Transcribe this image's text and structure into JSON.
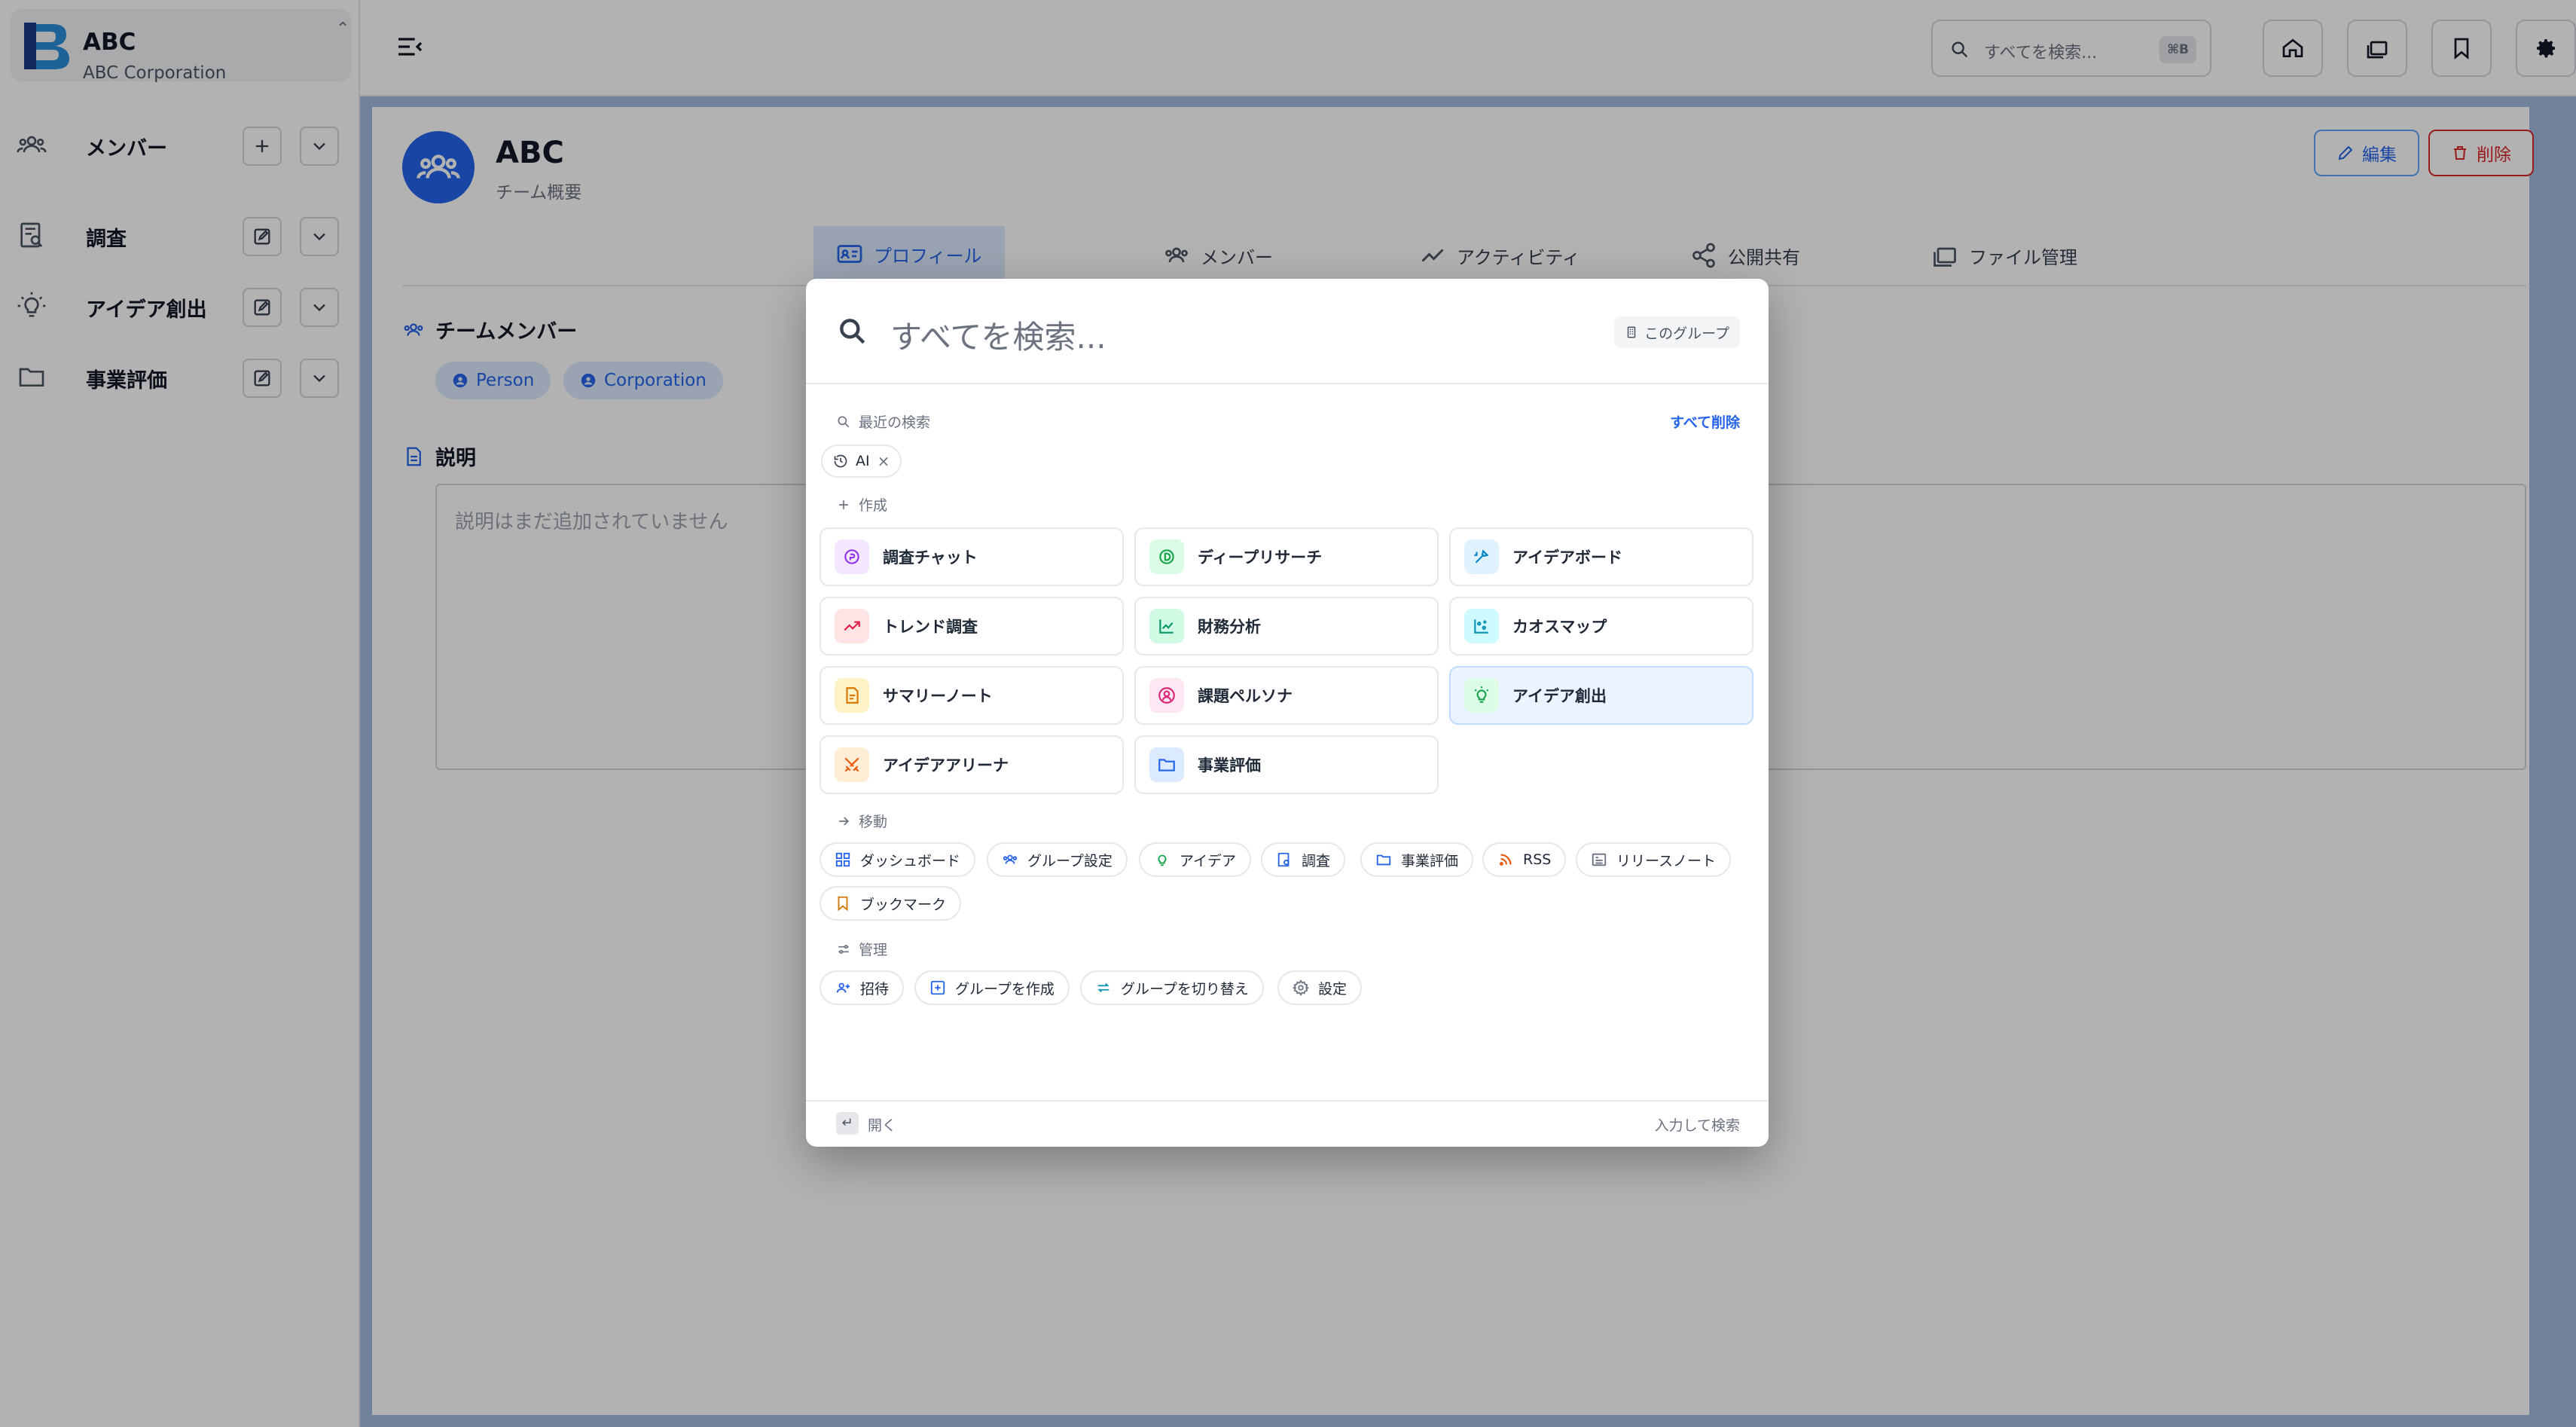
{
  "sidebar": {
    "org_name": "ABC",
    "org_subtitle": "ABC Corporation",
    "toggle_glyph": "⌃",
    "items": [
      {
        "label": "メンバー",
        "icon": "team-icon",
        "action_icon": "plus-icon"
      },
      {
        "label": "調査",
        "icon": "research-doc-icon",
        "action_icon": "edit-icon"
      },
      {
        "label": "アイデア創出",
        "icon": "lightbulb-icon",
        "action_icon": "edit-icon"
      },
      {
        "label": "事業評価",
        "icon": "folder-icon",
        "action_icon": "edit-icon"
      }
    ]
  },
  "header": {
    "search_placeholder": "すべてを検索...",
    "search_shortcut": "⌘B",
    "buttons": [
      "home-icon",
      "library-icon",
      "bookmark-icon",
      "settings-icon"
    ]
  },
  "main": {
    "team_name": "ABC",
    "team_subtitle": "チーム概要",
    "edit_label": "編集",
    "delete_label": "削除",
    "tabs": [
      {
        "label": "プロフィール",
        "active": true
      },
      {
        "label": "メンバー",
        "active": false
      },
      {
        "label": "アクティビティ",
        "active": false
      },
      {
        "label": "公開共有",
        "active": false
      },
      {
        "label": "ファイル管理",
        "active": false
      }
    ],
    "members_title": "チームメンバー",
    "member_chips": [
      "Person",
      "Corporation"
    ],
    "description_title": "説明",
    "description_placeholder": "説明はまだ追加されていません"
  },
  "palette": {
    "search_placeholder": "すべてを検索...",
    "scope_label": "このグループ",
    "recent_title": "最近の検索",
    "clear_all": "すべて削除",
    "recent_items": [
      "AI"
    ],
    "create_title": "作成",
    "create_items": [
      {
        "label": "調査チャット",
        "icon": "research-chat-icon",
        "color": "#9333ea",
        "bg": "#f3e8ff"
      },
      {
        "label": "ディープリサーチ",
        "icon": "deep-research-icon",
        "color": "#16a34a",
        "bg": "#dcfce7"
      },
      {
        "label": "アイデアボード",
        "icon": "idea-board-icon",
        "color": "#0284c7",
        "bg": "#e0f2fe"
      },
      {
        "label": "トレンド調査",
        "icon": "trend-icon",
        "color": "#e11d48",
        "bg": "#ffe4e6"
      },
      {
        "label": "財務分析",
        "icon": "finance-chart-icon",
        "color": "#059669",
        "bg": "#d1fae5"
      },
      {
        "label": "カオスマップ",
        "icon": "chaos-map-icon",
        "color": "#0891b2",
        "bg": "#cffafe"
      },
      {
        "label": "サマリーノート",
        "icon": "summary-note-icon",
        "color": "#d97706",
        "bg": "#fef3c7"
      },
      {
        "label": "課題ペルソナ",
        "icon": "persona-icon",
        "color": "#db2777",
        "bg": "#fce7f3"
      },
      {
        "label": "アイデア創出",
        "icon": "lightbulb-icon",
        "color": "#16a34a",
        "bg": "#dcfce7",
        "highlighted": true
      },
      {
        "label": "アイデアアリーナ",
        "icon": "arena-swords-icon",
        "color": "#ea580c",
        "bg": "#ffedd5"
      },
      {
        "label": "事業評価",
        "icon": "folder-icon",
        "color": "#2563eb",
        "bg": "#dbeafe"
      }
    ],
    "navigate_title": "移動",
    "navigate_items": [
      {
        "label": "ダッシュボード",
        "icon": "dashboard-icon",
        "color": "#2563eb"
      },
      {
        "label": "グループ設定",
        "icon": "group-icon",
        "color": "#2563eb"
      },
      {
        "label": "アイデア",
        "icon": "lightbulb-icon",
        "color": "#16a34a"
      },
      {
        "label": "調査",
        "icon": "research-doc-icon",
        "color": "#2563eb"
      },
      {
        "label": "事業評価",
        "icon": "folder-icon",
        "color": "#2563eb"
      },
      {
        "label": "RSS",
        "icon": "rss-icon",
        "color": "#ea580c"
      },
      {
        "label": "リリースノート",
        "icon": "release-notes-icon",
        "color": "#6b7280"
      },
      {
        "label": "ブックマーク",
        "icon": "bookmark-icon",
        "color": "#d97706"
      }
    ],
    "manage_title": "管理",
    "manage_items": [
      {
        "label": "招待",
        "icon": "invite-user-icon",
        "color": "#2563eb"
      },
      {
        "label": "グループを作成",
        "icon": "add-group-icon",
        "color": "#2563eb"
      },
      {
        "label": "グループを切り替え",
        "icon": "switch-icon",
        "color": "#0891b2"
      },
      {
        "label": "設定",
        "icon": "gear-icon",
        "color": "#6b7280"
      }
    ],
    "footer_enter_key": "↵",
    "footer_enter_label": "開く",
    "footer_hint": "入力して検索"
  }
}
